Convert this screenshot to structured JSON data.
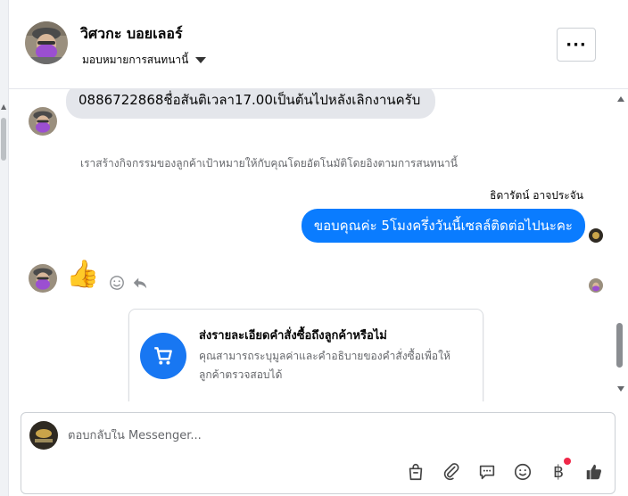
{
  "header": {
    "contact_name": "วิศวกะ บอยเลอร์",
    "assign_label": "มอบหมายการสนทนานี้",
    "more_label": "···"
  },
  "messages": {
    "incoming_text": "0886722868ชื่อสันติเวลา17.00เป็นต้นไปหลังเลิกงานครับ",
    "auto_note": "เราสร้างกิจกรรมของลูกค้าเป้าหมายให้กับคุณโดยอัตโนมัติโดยอิงตามการสนทนานี้",
    "sender_name": "ธิดารัตน์ อาจประจัน",
    "outgoing_text": "ขอบคุณค่ะ 5โมงครึ่งวันนี้เซลล์ติดต่อไปนะคะ",
    "reaction_emoji": "👍"
  },
  "order_card": {
    "title": "ส่งรายละเอียดคำสั่งซื้อถึงลูกค้าหรือไม่",
    "body": "คุณสามารถระบุมูลค่าและคำอธิบายของคำสั่งซื้อเพื่อให้ลูกค้าตรวจสอบได้"
  },
  "composer": {
    "placeholder": "ตอบกลับใน Messenger..."
  },
  "toolbar": {
    "icons": [
      "shopping-bag-icon",
      "paperclip-icon",
      "chat-bubble-icon",
      "emoji-icon",
      "baht-icon",
      "thumbs-up-icon"
    ],
    "baht_symbol": "฿",
    "accent_color": "#0a7cff",
    "badge_color": "#f02849"
  }
}
